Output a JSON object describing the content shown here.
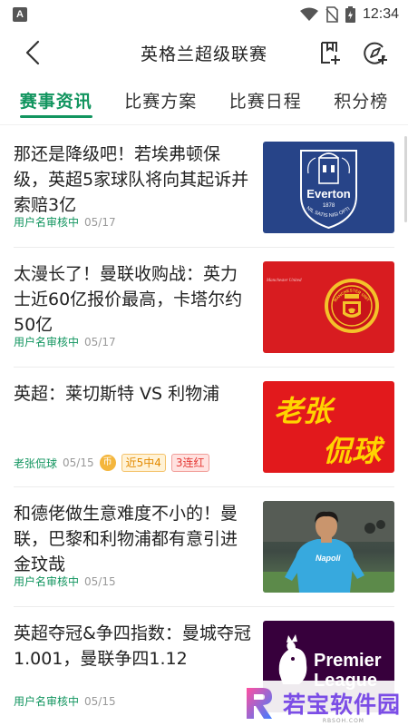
{
  "status_bar": {
    "time": "12:34",
    "app_letter": "A"
  },
  "header": {
    "title": "英格兰超级联赛"
  },
  "tabs": [
    {
      "label": "赛事资讯",
      "active": true
    },
    {
      "label": "比赛方案",
      "active": false
    },
    {
      "label": "比赛日程",
      "active": false
    },
    {
      "label": "积分榜",
      "active": false
    }
  ],
  "news": [
    {
      "title": "那还是降级吧！若埃弗顿保级，英超5家球队将向其起诉并索赔3亿",
      "source": "用户名审核中",
      "date": "05/17",
      "thumb": "everton-logo",
      "logo_text": "Everton",
      "logo_year": "1878",
      "logo_motto": "NIL SATIS NISI OPTIMUM"
    },
    {
      "title": "太漫长了！曼联收购战：英力士近60亿报价最高，卡塔尔约50亿",
      "source": "用户名审核中",
      "date": "05/17",
      "thumb": "manchester-united-logo",
      "logo_name": "MANCHESTER UNITED",
      "logo_caption": "Manchester United"
    },
    {
      "title": "英超：莱切斯特 VS 利物浦",
      "source": "老张侃球",
      "date": "05/15",
      "coin": "币",
      "streak": "近5中4",
      "red_streak": "3连红",
      "thumb": "calligraphy",
      "calligraphy_1": "老张",
      "calligraphy_2": "侃球"
    },
    {
      "title": "和德佬做生意难度不小的！曼联，巴黎和利物浦都有意引进金玟哉",
      "source": "用户名审核中",
      "date": "05/15",
      "thumb": "footballer-photo",
      "jersey_text": "Napoli"
    },
    {
      "title": "英超夺冠&争四指数：曼城夺冠1.001，曼联争四1.12",
      "source": "用户名审核中",
      "date": "05/15",
      "thumb": "premier-league-logo",
      "logo_line1": "Premier",
      "logo_line2": "League"
    }
  ],
  "watermark": {
    "text": "若宝软件园",
    "sub": "RBSOH.COM"
  },
  "colors": {
    "accent": "#12955f",
    "everton_blue": "#274488",
    "manutd_red": "#d81c20",
    "pl_purple": "#37003c"
  }
}
